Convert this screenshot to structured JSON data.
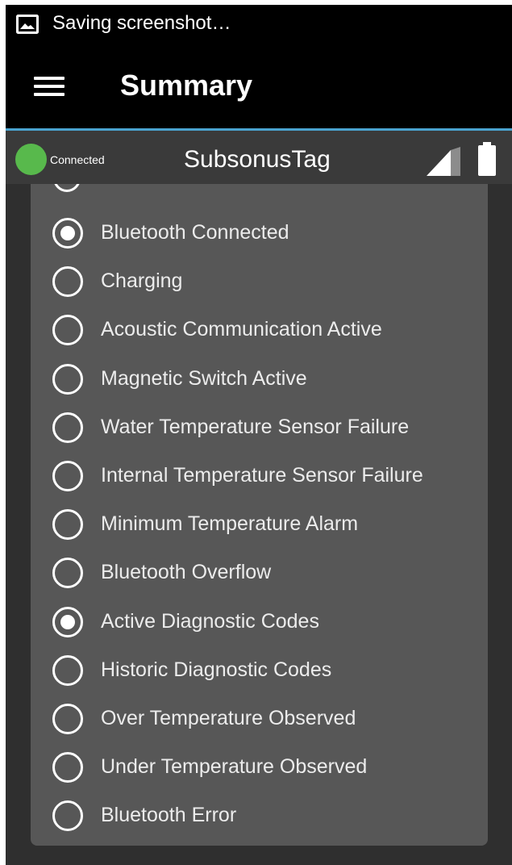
{
  "status_bar": {
    "notification_icon": "image-icon",
    "text": "Saving screenshot…"
  },
  "app_bar": {
    "menu_icon": "hamburger-menu-icon",
    "title": "Summary",
    "accent_color": "#4aa3cf"
  },
  "device_bar": {
    "connection_status": "Connected",
    "connection_color": "#58b94c",
    "device_name": "SubsonusTag",
    "signal_icon": "signal-strength-icon",
    "battery_icon": "battery-full-icon"
  },
  "status_list": {
    "items": [
      {
        "label": "Bluetooth Connected",
        "checked": true
      },
      {
        "label": "Charging",
        "checked": false
      },
      {
        "label": "Acoustic Communication Active",
        "checked": false
      },
      {
        "label": "Magnetic Switch Active",
        "checked": false
      },
      {
        "label": "Water Temperature Sensor Failure",
        "checked": false
      },
      {
        "label": "Internal Temperature Sensor Failure",
        "checked": false
      },
      {
        "label": "Minimum Temperature Alarm",
        "checked": false
      },
      {
        "label": "Bluetooth Overflow",
        "checked": false
      },
      {
        "label": "Active Diagnostic Codes",
        "checked": true
      },
      {
        "label": "Historic Diagnostic Codes",
        "checked": false
      },
      {
        "label": "Over Temperature Observed",
        "checked": false
      },
      {
        "label": "Under Temperature Observed",
        "checked": false
      },
      {
        "label": "Bluetooth Error",
        "checked": false
      }
    ]
  }
}
